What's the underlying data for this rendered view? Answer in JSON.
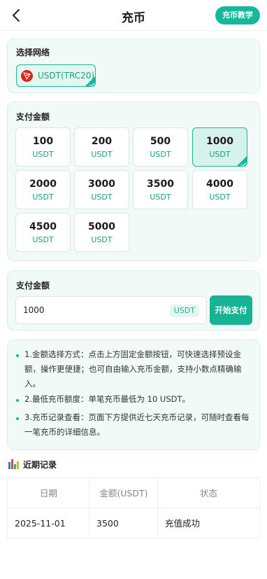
{
  "header": {
    "title": "充币",
    "tutorial_label": "充币教学"
  },
  "network": {
    "section_title": "选择网络",
    "selected": "USDT(TRC20)"
  },
  "amounts": {
    "section_title": "支付金额",
    "unit": "USDT",
    "options": [
      "100",
      "200",
      "500",
      "1000",
      "2000",
      "3000",
      "3500",
      "4000",
      "4500",
      "5000"
    ],
    "selected": "1000"
  },
  "pay": {
    "section_title": "支付金额",
    "input_value": "1000",
    "unit": "USDT",
    "button_label": "开始支付"
  },
  "tips": [
    "1.金额选择方式：点击上方固定金额按钮，可快速选择预设金额，操作更便捷；也可自由输入充币金额，支持小数点精确输入。",
    "2.最低充币额度：单笔充币最低为 10 USDT。",
    "3.充币记录查看：页面下方提供近七天充币记录，可随时查看每一笔充币的详细信息。"
  ],
  "records": {
    "title": "近期记录",
    "columns": [
      "日期",
      "金额(USDT)",
      "状态"
    ],
    "rows": [
      {
        "date": "2025-11-01",
        "amount": "3500",
        "status": "充值成功"
      }
    ]
  },
  "colors": {
    "accent": "#16b79a",
    "card_bg": "#f1faf7",
    "tron_red": "#e0261c"
  },
  "icons": {
    "back": "chevron-left-icon",
    "network": "tron-icon",
    "selected_mark": "check-icon",
    "records": "bar-chart-icon"
  }
}
